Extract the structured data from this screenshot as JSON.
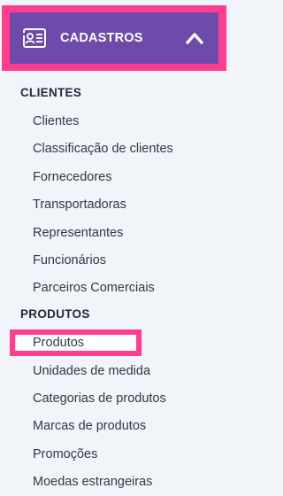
{
  "header": {
    "title": "CADASTROS",
    "icon": "contact-card-icon",
    "chevron_icon": "chevron-up-icon",
    "background_color": "#6e4bab",
    "highlight_color": "#ff3f8e"
  },
  "sections": [
    {
      "heading": "CLIENTES",
      "items": [
        "Clientes",
        "Classificação de clientes",
        "Fornecedores",
        "Transportadoras",
        "Representantes",
        "Funcionários",
        "Parceiros Comerciais"
      ]
    },
    {
      "heading": "PRODUTOS",
      "items": [
        "Produtos",
        "Unidades de medida",
        "Categorias de produtos",
        "Marcas de produtos",
        "Promoções",
        "Moedas estrangeiras"
      ]
    }
  ]
}
